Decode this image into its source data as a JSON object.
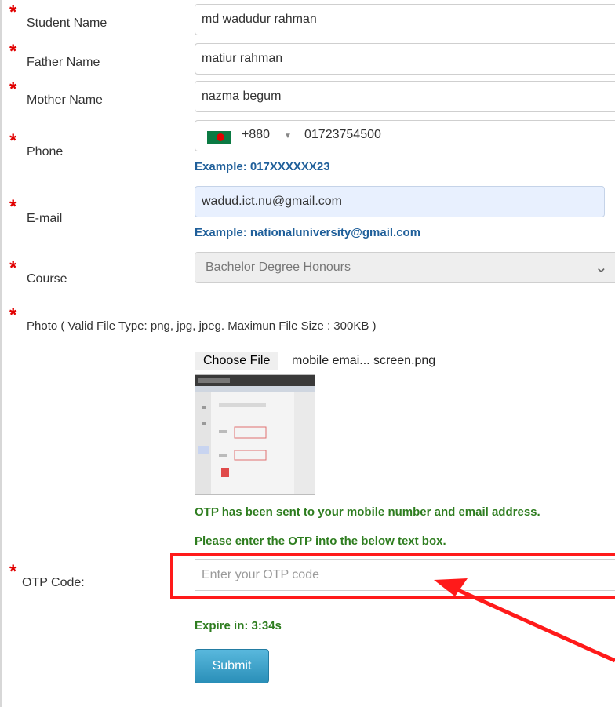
{
  "form": {
    "student_name": {
      "label": "Student Name",
      "value": "md wadudur rahman"
    },
    "father_name": {
      "label": "Father Name",
      "value": "matiur rahman"
    },
    "mother_name": {
      "label": "Mother Name",
      "value": "nazma begum"
    },
    "phone": {
      "label": "Phone",
      "country_code": "+880",
      "value": "01723754500",
      "hint": "Example: 017XXXXXX23",
      "flag_icon": "bangladesh-flag-icon"
    },
    "email": {
      "label": "E-mail",
      "value": "wadud.ict.nu@gmail.com",
      "hint": "Example: nationaluniversity@gmail.com"
    },
    "course": {
      "label": "Course",
      "value": "Bachelor Degree Honours"
    },
    "photo": {
      "label": "Photo ( Valid File Type: png, jpg, jpeg. Maximun File Size : 300KB )",
      "button": "Choose File",
      "file_name": "mobile emai... screen.png"
    },
    "otp": {
      "sent_message": "OTP has been sent to your mobile number and email address.",
      "instruction": "Please enter the OTP into the below text box.",
      "label": "OTP Code:",
      "placeholder": "Enter your OTP code",
      "expire": "Expire in: 3:34s"
    },
    "submit_label": "Submit"
  },
  "required_marker": "*",
  "colors": {
    "required": "#e10000",
    "hint": "#1f5f9a",
    "success": "#2e7d1f",
    "highlight": "#ff1a1a",
    "button": "#2a8fb8"
  }
}
